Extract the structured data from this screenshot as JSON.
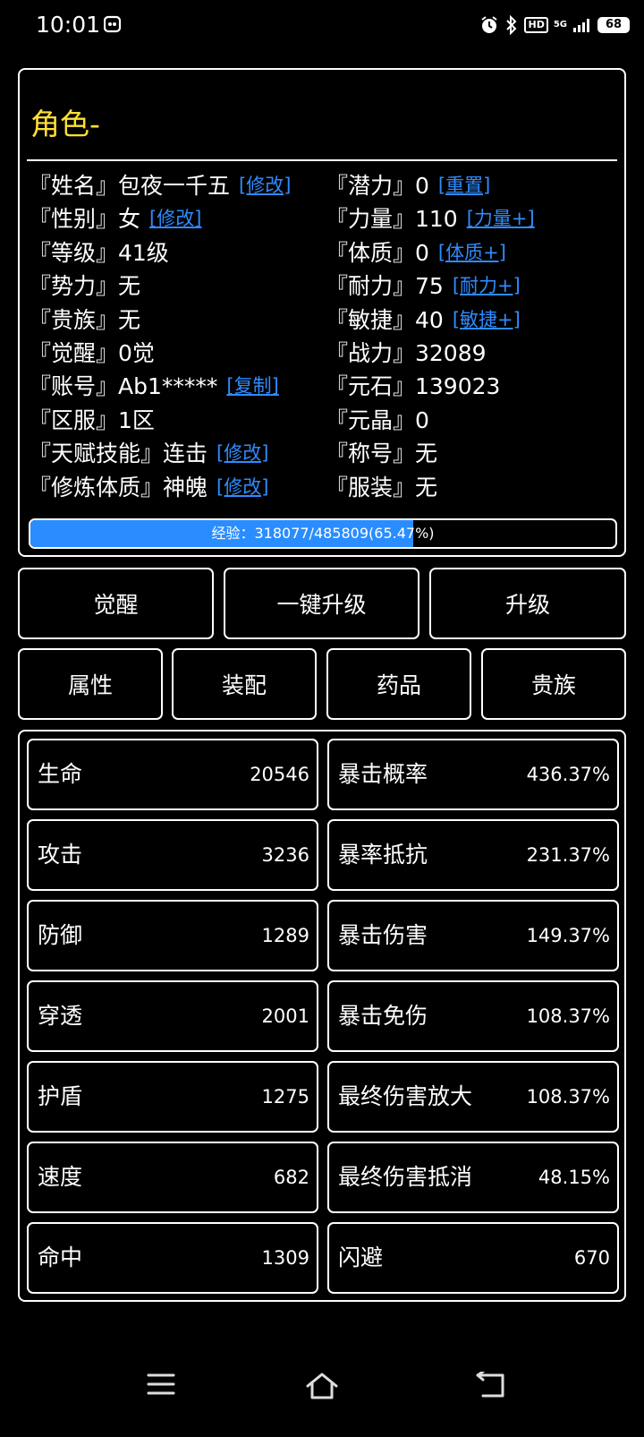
{
  "status_bar": {
    "time": "10:01",
    "network": "5G",
    "hd": "HD",
    "battery": "68"
  },
  "character": {
    "title": "角色-",
    "left_rows": [
      {
        "label": "『姓名』包夜一千五",
        "action": "[修改]"
      },
      {
        "label": "『性别』女",
        "action": "[修改]"
      },
      {
        "label": "『等级』41级",
        "action": ""
      },
      {
        "label": "『势力』无",
        "action": ""
      },
      {
        "label": "『贵族』无",
        "action": ""
      },
      {
        "label": "『觉醒』0觉",
        "action": ""
      },
      {
        "label": "『账号』Ab1*****",
        "action": "[复制]"
      },
      {
        "label": "『区服』1区",
        "action": ""
      },
      {
        "label": "『天赋技能』连击",
        "action": "[修改]"
      },
      {
        "label": "『修炼体质』神魄",
        "action": "[修改]"
      }
    ],
    "right_rows": [
      {
        "label": "『潜力』0",
        "action": "[重置]"
      },
      {
        "label": "『力量』110",
        "action": "[力量+]"
      },
      {
        "label": "『体质』0",
        "action": "[体质+]"
      },
      {
        "label": "『耐力』75",
        "action": "[耐力+]"
      },
      {
        "label": "『敏捷』40",
        "action": "[敏捷+]"
      },
      {
        "label": "『战力』32089",
        "action": ""
      },
      {
        "label": "『元石』139023",
        "action": ""
      },
      {
        "label": "『元晶』0",
        "action": ""
      },
      {
        "label": "『称号』无",
        "action": ""
      },
      {
        "label": "『服装』无",
        "action": ""
      }
    ],
    "exp": {
      "text": "经验：318077/485809(65.47%)",
      "percent": 65.47
    }
  },
  "action_buttons": [
    "觉醒",
    "一键升级",
    "升级"
  ],
  "tabs": [
    "属性",
    "装配",
    "药品",
    "贵族"
  ],
  "stats": {
    "left": [
      {
        "name": "生命",
        "value": "20546"
      },
      {
        "name": "攻击",
        "value": "3236"
      },
      {
        "name": "防御",
        "value": "1289"
      },
      {
        "name": "穿透",
        "value": "2001"
      },
      {
        "name": "护盾",
        "value": "1275"
      },
      {
        "name": "速度",
        "value": "682"
      },
      {
        "name": "命中",
        "value": "1309"
      }
    ],
    "right": [
      {
        "name": "暴击概率",
        "value": "436.37%"
      },
      {
        "name": "暴率抵抗",
        "value": "231.37%"
      },
      {
        "name": "暴击伤害",
        "value": "149.37%"
      },
      {
        "name": "暴击免伤",
        "value": "108.37%"
      },
      {
        "name": "最终伤害放大",
        "value": "108.37%"
      },
      {
        "name": "最终伤害抵消",
        "value": "48.15%"
      },
      {
        "name": "闪避",
        "value": "670"
      }
    ]
  },
  "colors": {
    "title": "#ffe033",
    "link": "#2f8bff",
    "exp_fill": "#2a8dff"
  }
}
